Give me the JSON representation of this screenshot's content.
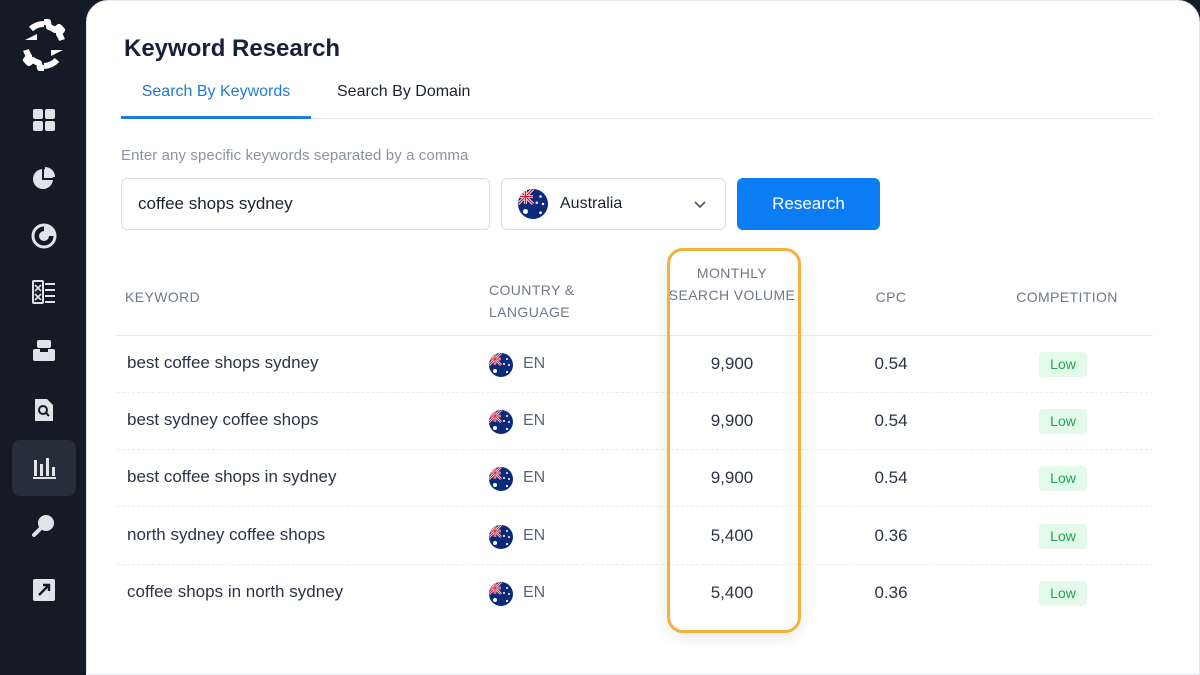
{
  "sidebar": {
    "icons": [
      "logo-icon",
      "dashboard-icon",
      "pie-chart-icon",
      "gauge-icon",
      "checklist-icon",
      "inbox-icon",
      "doc-search-icon",
      "bar-chart-icon",
      "key-icon",
      "external-link-icon"
    ]
  },
  "header": {
    "title": "Keyword Research"
  },
  "tabs": [
    {
      "label": "Search By Keywords",
      "active": true
    },
    {
      "label": "Search By Domain",
      "active": false
    }
  ],
  "search": {
    "hint": "Enter any specific keywords separated by a comma",
    "value": "coffee shops sydney",
    "country": "Australia",
    "button_label": "Research"
  },
  "table": {
    "columns": [
      "KEYWORD",
      "COUNTRY & LANGUAGE",
      "MONTHLY SEARCH VOLUME",
      "CPC",
      "COMPETITION"
    ],
    "rows": [
      {
        "keyword": "best coffee shops sydney",
        "lang": "EN",
        "volume": "9,900",
        "cpc": "0.54",
        "competition": "Low"
      },
      {
        "keyword": "best sydney coffee shops",
        "lang": "EN",
        "volume": "9,900",
        "cpc": "0.54",
        "competition": "Low"
      },
      {
        "keyword": "best coffee shops in sydney",
        "lang": "EN",
        "volume": "9,900",
        "cpc": "0.54",
        "competition": "Low"
      },
      {
        "keyword": "north sydney coffee shops",
        "lang": "EN",
        "volume": "5,400",
        "cpc": "0.36",
        "competition": "Low"
      },
      {
        "keyword": "coffee shops in north sydney",
        "lang": "EN",
        "volume": "5,400",
        "cpc": "0.36",
        "competition": "Low"
      }
    ]
  },
  "colors": {
    "accent": "#0a7df5",
    "highlight": "#f2b23d",
    "badge_low_bg": "#e3f9ea",
    "badge_low_text": "#1ea552",
    "sidebar_bg": "#151b26"
  }
}
